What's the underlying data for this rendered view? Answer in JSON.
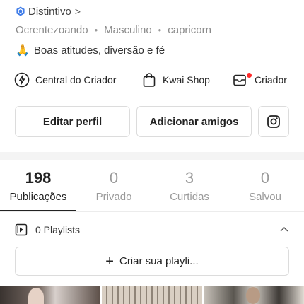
{
  "profile": {
    "badge_label": "Distintivo",
    "badge_chevron": ">",
    "meta": [
      "Ocrentezoando",
      "Masculino",
      "capricorn"
    ],
    "meta_separator": "•",
    "bio_emoji": "🙏",
    "bio": "Boas atitudes, diversão e fé"
  },
  "links": {
    "central": "Central do Criador",
    "shop": "Kwai Shop",
    "criador": "Criador"
  },
  "buttons": {
    "edit": "Editar perfil",
    "add_friends": "Adicionar amigos"
  },
  "stats": [
    {
      "value": "198",
      "label": "Publicações"
    },
    {
      "value": "0",
      "label": "Privado"
    },
    {
      "value": "3",
      "label": "Curtidas"
    },
    {
      "value": "0",
      "label": "Salvou"
    }
  ],
  "playlist": {
    "label": "0 Playlists",
    "create_plus": "+",
    "create_label": "Criar sua playli..."
  },
  "colors": {
    "badge_blue": "#3f7ce8",
    "notification_red": "#ff2a2a",
    "inactive_gray": "#9a9a9a"
  },
  "icons": [
    "badge-icon",
    "lightning-icon",
    "shopping-bag-icon",
    "creator-icon",
    "instagram-icon",
    "playlist-icon",
    "chevron-up-icon"
  ]
}
